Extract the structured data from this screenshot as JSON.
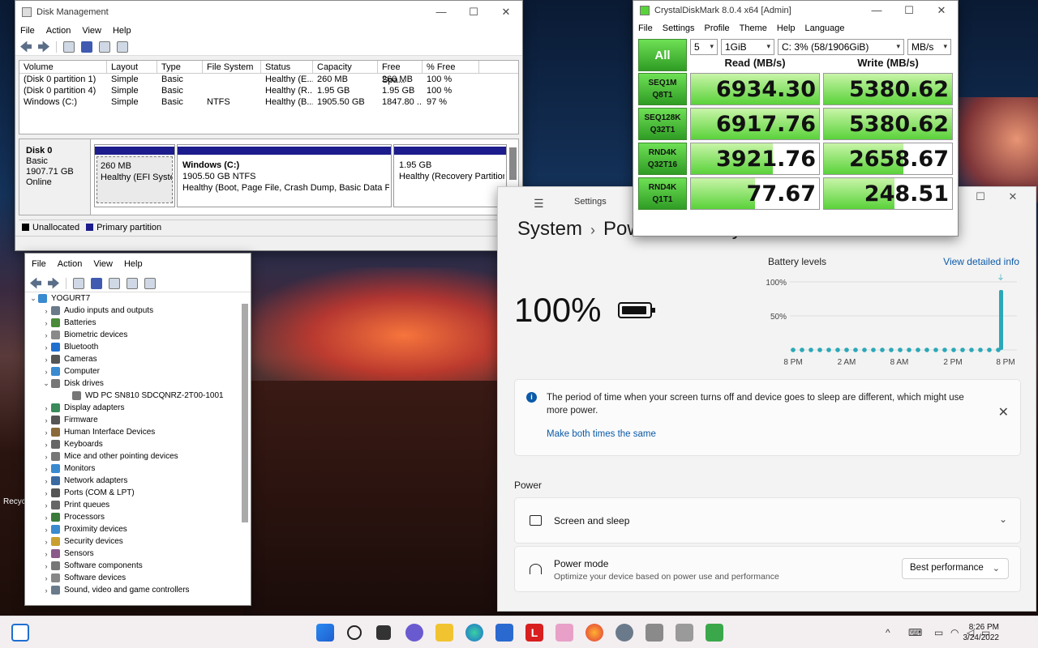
{
  "disk_mgmt": {
    "title": "Disk Management",
    "menu": [
      "File",
      "Action",
      "View",
      "Help"
    ],
    "columns": [
      "Volume",
      "Layout",
      "Type",
      "File System",
      "Status",
      "Capacity",
      "Free Spa...",
      "% Free"
    ],
    "rows": [
      [
        "(Disk 0 partition 1)",
        "Simple",
        "Basic",
        "",
        "Healthy (E...",
        "260 MB",
        "260 MB",
        "100 %"
      ],
      [
        "(Disk 0 partition 4)",
        "Simple",
        "Basic",
        "",
        "Healthy (R...",
        "1.95 GB",
        "1.95 GB",
        "100 %"
      ],
      [
        "Windows (C:)",
        "Simple",
        "Basic",
        "NTFS",
        "Healthy (B...",
        "1905.50 GB",
        "1847.80 ...",
        "97 %"
      ]
    ],
    "disk": {
      "name": "Disk 0",
      "type": "Basic",
      "size": "1907.71 GB",
      "state": "Online"
    },
    "partitions": [
      {
        "name": "",
        "size": "260 MB",
        "status": "Healthy (EFI System"
      },
      {
        "name": "Windows  (C:)",
        "size": "1905.50 GB NTFS",
        "status": "Healthy (Boot, Page File, Crash Dump, Basic Data Partition"
      },
      {
        "name": "",
        "size": "1.95 GB",
        "status": "Healthy (Recovery Partition)"
      }
    ],
    "legend": [
      {
        "label": "Unallocated",
        "color": "#000000"
      },
      {
        "label": "Primary partition",
        "color": "#1c1c8c"
      }
    ]
  },
  "device_mgr": {
    "menu": [
      "File",
      "Action",
      "View",
      "Help"
    ],
    "root": "YOGURT7",
    "items": [
      {
        "label": "Audio inputs and outputs",
        "expanded": false,
        "icon": "speaker-icon",
        "color": "#6a7a8a"
      },
      {
        "label": "Batteries",
        "expanded": false,
        "icon": "battery-icon",
        "color": "#4a8a3a"
      },
      {
        "label": "Biometric devices",
        "expanded": false,
        "icon": "fingerprint-icon",
        "color": "#8a8a8a"
      },
      {
        "label": "Bluetooth",
        "expanded": false,
        "icon": "bluetooth-icon",
        "color": "#1f6fd0"
      },
      {
        "label": "Cameras",
        "expanded": false,
        "icon": "camera-icon",
        "color": "#555555"
      },
      {
        "label": "Computer",
        "expanded": false,
        "icon": "computer-icon",
        "color": "#3a8ad0"
      },
      {
        "label": "Disk drives",
        "expanded": true,
        "icon": "disk-icon",
        "color": "#777777"
      },
      {
        "label": "WD PC SN810 SDCQNRZ-2T00-1001",
        "child": true,
        "icon": "disk-icon",
        "color": "#777777"
      },
      {
        "label": "Display adapters",
        "expanded": false,
        "icon": "display-icon",
        "color": "#3a8a5a"
      },
      {
        "label": "Firmware",
        "expanded": false,
        "icon": "chip-icon",
        "color": "#555555"
      },
      {
        "label": "Human Interface Devices",
        "expanded": false,
        "icon": "hid-icon",
        "color": "#8a6a3a"
      },
      {
        "label": "Keyboards",
        "expanded": false,
        "icon": "keyboard-icon",
        "color": "#666666"
      },
      {
        "label": "Mice and other pointing devices",
        "expanded": false,
        "icon": "mouse-icon",
        "color": "#777777"
      },
      {
        "label": "Monitors",
        "expanded": false,
        "icon": "monitor-icon",
        "color": "#3a8ad0"
      },
      {
        "label": "Network adapters",
        "expanded": false,
        "icon": "network-icon",
        "color": "#3a6aa0"
      },
      {
        "label": "Ports (COM & LPT)",
        "expanded": false,
        "icon": "port-icon",
        "color": "#555555"
      },
      {
        "label": "Print queues",
        "expanded": false,
        "icon": "printer-icon",
        "color": "#666666"
      },
      {
        "label": "Processors",
        "expanded": false,
        "icon": "cpu-icon",
        "color": "#3a7a3a"
      },
      {
        "label": "Proximity devices",
        "expanded": false,
        "icon": "proximity-icon",
        "color": "#3a8ad0"
      },
      {
        "label": "Security devices",
        "expanded": false,
        "icon": "security-icon",
        "color": "#c9a030"
      },
      {
        "label": "Sensors",
        "expanded": false,
        "icon": "sensor-icon",
        "color": "#8a5a8a"
      },
      {
        "label": "Software components",
        "expanded": false,
        "icon": "puzzle-icon",
        "color": "#777777"
      },
      {
        "label": "Software devices",
        "expanded": false,
        "icon": "software-icon",
        "color": "#888888"
      },
      {
        "label": "Sound, video and game controllers",
        "expanded": false,
        "icon": "sound-icon",
        "color": "#6a7a8a"
      }
    ]
  },
  "settings": {
    "title": "Settings",
    "breadcrumb_parent": "System",
    "breadcrumb_current": "Power & battery",
    "battery_percent": "100%",
    "battery_levels_title": "Battery levels",
    "view_detailed": "View detailed info",
    "chart_y_labels": [
      "100%",
      "50%"
    ],
    "chart_x_labels": [
      "8 PM",
      "2 AM",
      "8 AM",
      "2 PM",
      "8 PM"
    ],
    "notice_text": "The period of time when your screen turns off and device goes to sleep are different, which might use more power.",
    "notice_link": "Make both times the same",
    "power_section": "Power",
    "screen_sleep": "Screen and sleep",
    "power_mode_title": "Power mode",
    "power_mode_sub": "Optimize your device based on power use and performance",
    "power_mode_value": "Best performance"
  },
  "cdm": {
    "title": "CrystalDiskMark 8.0.4 x64 [Admin]",
    "menu": [
      "File",
      "Settings",
      "Profile",
      "Theme",
      "Help",
      "Language"
    ],
    "all": "All",
    "count": "5",
    "size": "1GiB",
    "drive": "C: 3% (58/1906GiB)",
    "unit": "MB/s",
    "read_header": "Read (MB/s)",
    "write_header": "Write (MB/s)",
    "tests": [
      {
        "l1": "SEQ1M",
        "l2": "Q8T1",
        "read": "6934.30",
        "write": "5380.62",
        "read_frac": 1.0,
        "write_frac": 1.0
      },
      {
        "l1": "SEQ128K",
        "l2": "Q32T1",
        "read": "6917.76",
        "write": "5380.62",
        "read_frac": 1.0,
        "write_frac": 1.0
      },
      {
        "l1": "RND4K",
        "l2": "Q32T16",
        "read": "3921.76",
        "write": "2658.67",
        "read_frac": 0.64,
        "write_frac": 0.62
      },
      {
        "l1": "RND4K",
        "l2": "Q1T1",
        "read": "77.67",
        "write": "248.51",
        "read_frac": 0.5,
        "write_frac": 0.55
      }
    ]
  },
  "taskbar": {
    "time": "8:26 PM",
    "date": "3/24/2022"
  },
  "desktop": {
    "recycle": "Recycle"
  }
}
